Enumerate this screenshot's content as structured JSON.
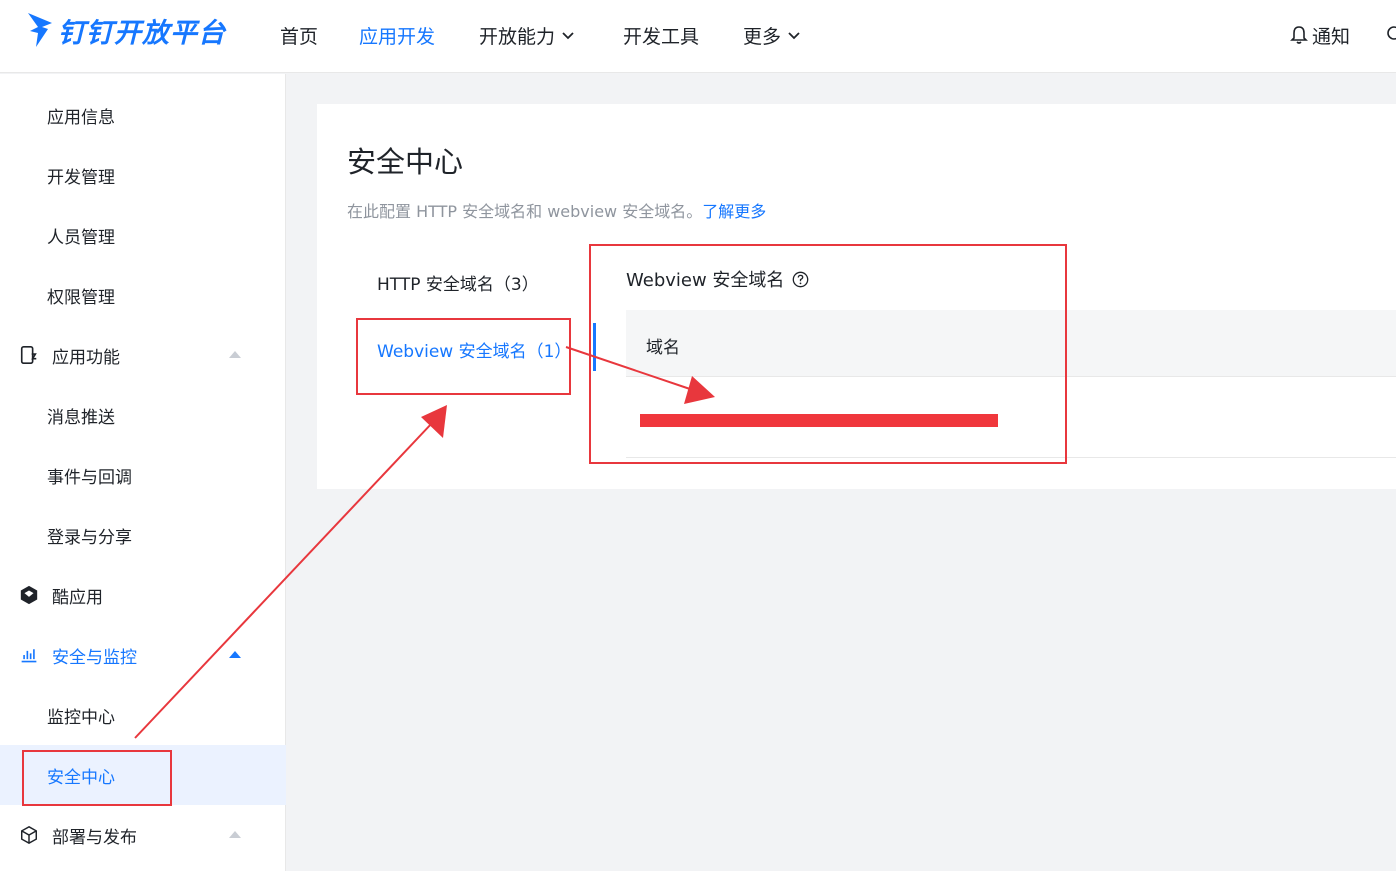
{
  "header": {
    "brand": "钉钉开放平台",
    "nav": [
      {
        "label": "首页",
        "dropdown": false,
        "active": false
      },
      {
        "label": "应用开发",
        "dropdown": false,
        "active": true
      },
      {
        "label": "开放能力",
        "dropdown": true,
        "active": false
      },
      {
        "label": "开发工具",
        "dropdown": false,
        "active": false
      },
      {
        "label": "更多",
        "dropdown": true,
        "active": false
      }
    ],
    "notify_label": "通知"
  },
  "sidebar": {
    "items": [
      {
        "label": "应用信息",
        "type": "sub"
      },
      {
        "label": "开发管理",
        "type": "sub"
      },
      {
        "label": "人员管理",
        "type": "sub"
      },
      {
        "label": "权限管理",
        "type": "sub"
      },
      {
        "label": "应用功能",
        "type": "group",
        "icon": "app-function-icon",
        "expanded": true
      },
      {
        "label": "消息推送",
        "type": "sub"
      },
      {
        "label": "事件与回调",
        "type": "sub"
      },
      {
        "label": "登录与分享",
        "type": "sub"
      },
      {
        "label": "酷应用",
        "type": "group",
        "icon": "cool-app-icon"
      },
      {
        "label": "安全与监控",
        "type": "group",
        "icon": "chart-bar-icon",
        "expanded": true,
        "active": true
      },
      {
        "label": "监控中心",
        "type": "sub"
      },
      {
        "label": "安全中心",
        "type": "sub",
        "selected": true
      },
      {
        "label": "部署与发布",
        "type": "group",
        "icon": "cube-icon",
        "expanded": true
      }
    ]
  },
  "main": {
    "title": "安全中心",
    "description": "在此配置 HTTP 安全域名和 webview 安全域名。",
    "learn_more": "了解更多",
    "tabs": [
      {
        "label": "HTTP 安全域名（3）"
      },
      {
        "label": "Webview 安全域名（1）",
        "active": true
      }
    ],
    "section_title": "Webview 安全域名",
    "table": {
      "columns": [
        "域名"
      ],
      "rows": [
        [
          "redacted"
        ]
      ]
    }
  },
  "colors": {
    "accent": "#1677ff",
    "annotation": "#e8373d"
  }
}
